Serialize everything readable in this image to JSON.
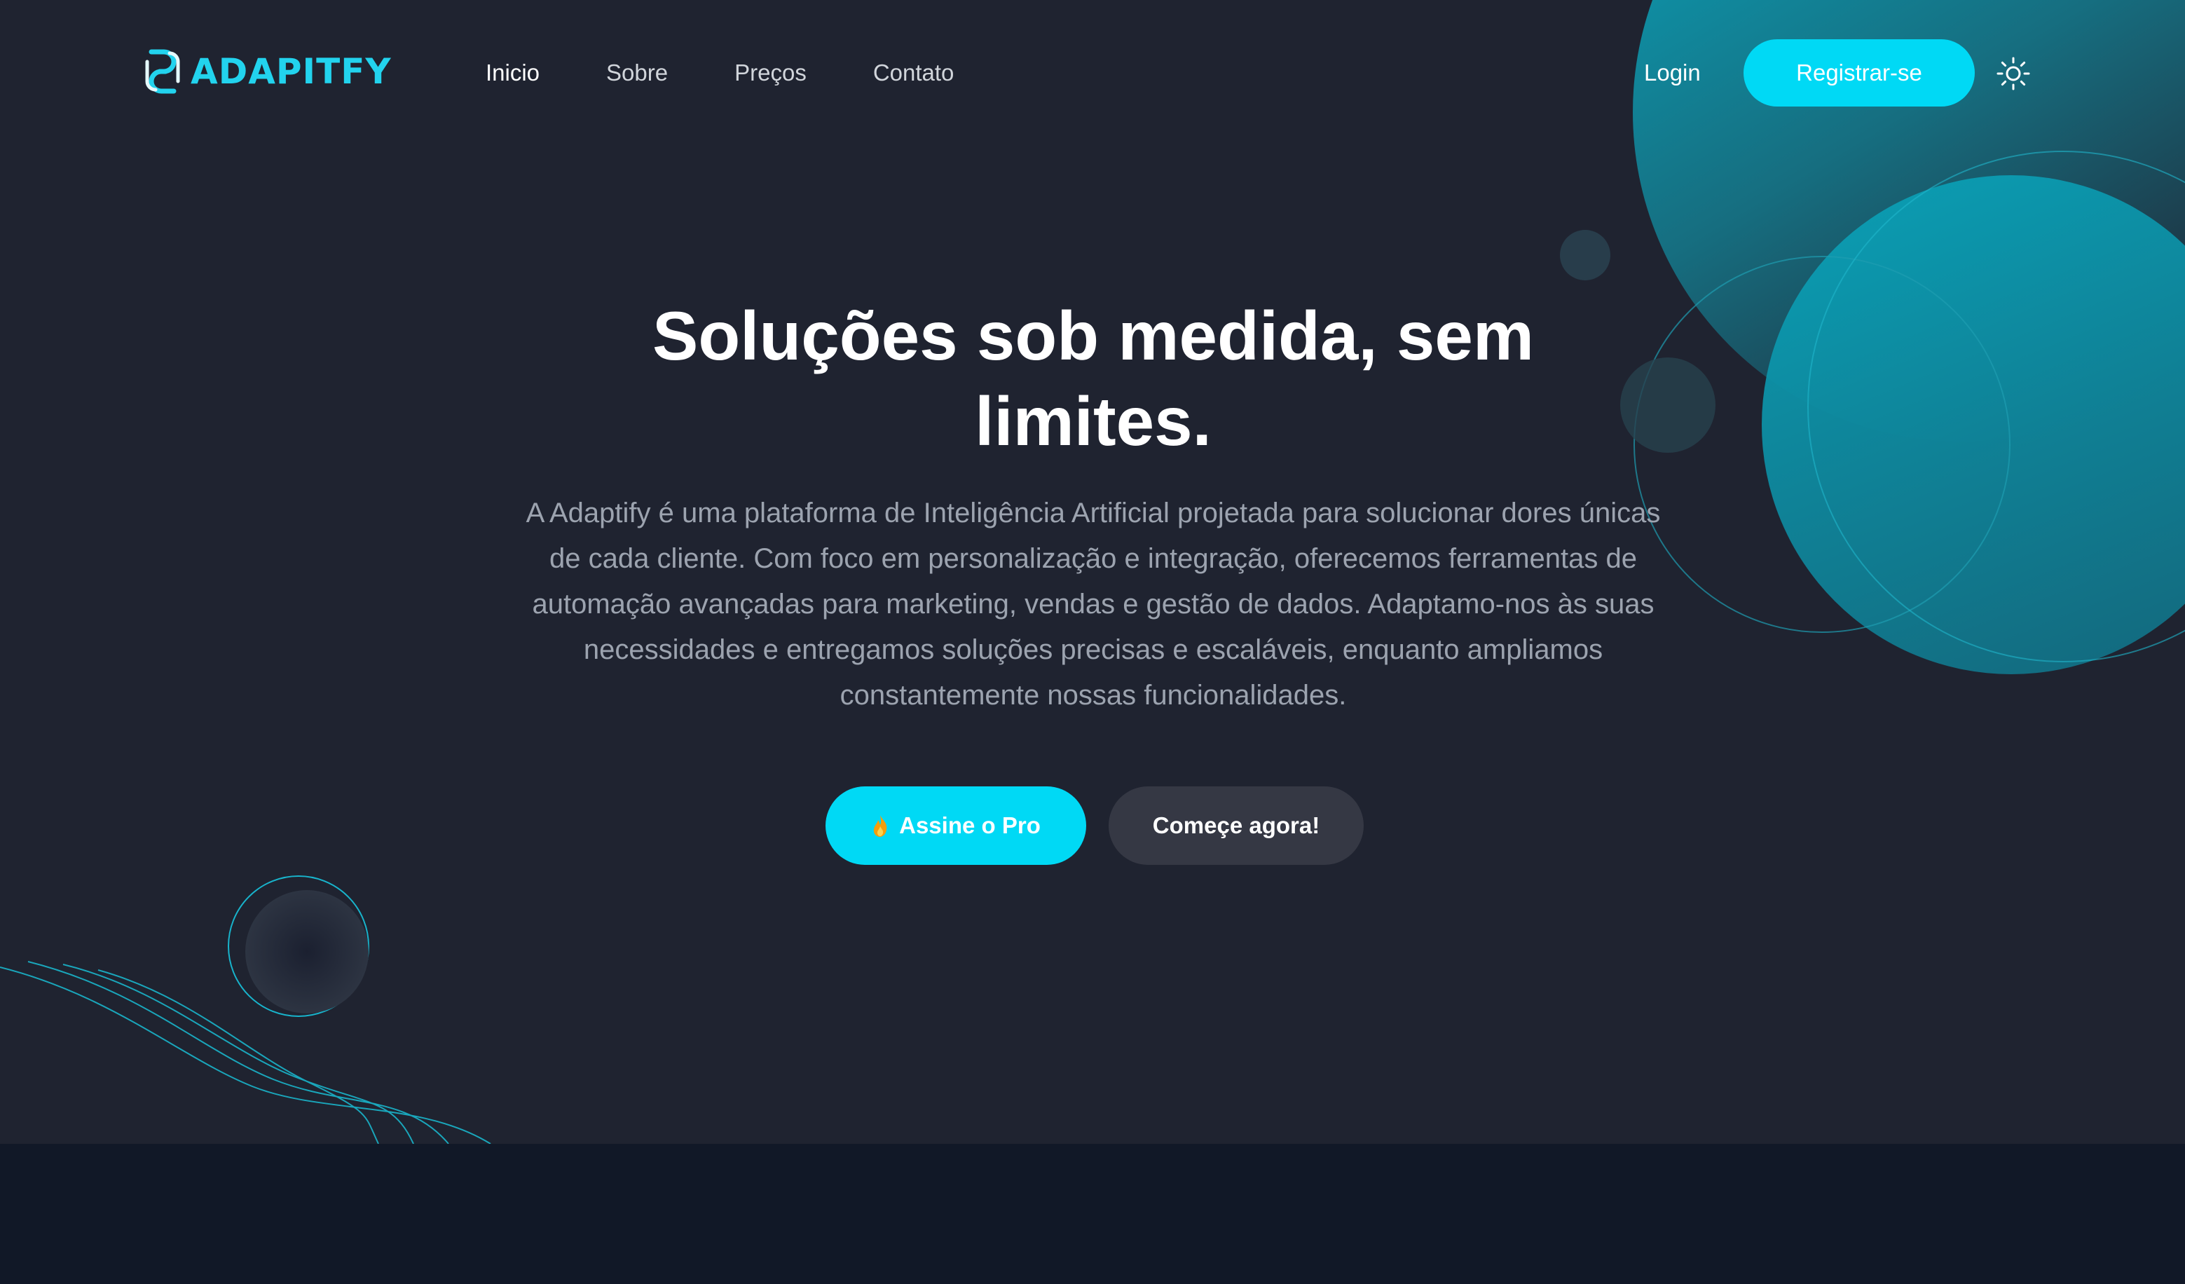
{
  "brand": {
    "logo_text": "ADAPITFY"
  },
  "nav": {
    "links": [
      {
        "label": "Inicio",
        "active": true
      },
      {
        "label": "Sobre",
        "active": false
      },
      {
        "label": "Preços",
        "active": false
      },
      {
        "label": "Contato",
        "active": false
      }
    ],
    "login_label": "Login",
    "register_label": "Registrar-se",
    "theme_icon": "sun-icon"
  },
  "hero": {
    "title_line1": "Soluções sob medida, sem",
    "title_line2": "limites.",
    "description": "A Adaptify é uma plataforma de Inteligência Artificial projetada para solucionar dores únicas de cada cliente. Com foco em personalização e integração, oferecemos ferramentas de automação avançadas para marketing, vendas e gestão de dados. Adaptamo-nos às suas necessidades e entregamos soluções precisas e escaláveis, enquanto ampliamos constantemente nossas funcionalidades.",
    "cta_primary_label": "Assine o Pro",
    "cta_primary_icon": "flame-icon",
    "cta_secondary_label": "Começe agora!"
  },
  "colors": {
    "accent": "#00d9f5",
    "background": "#1f2330",
    "footer_background": "#111827",
    "secondary_button": "#353844"
  }
}
